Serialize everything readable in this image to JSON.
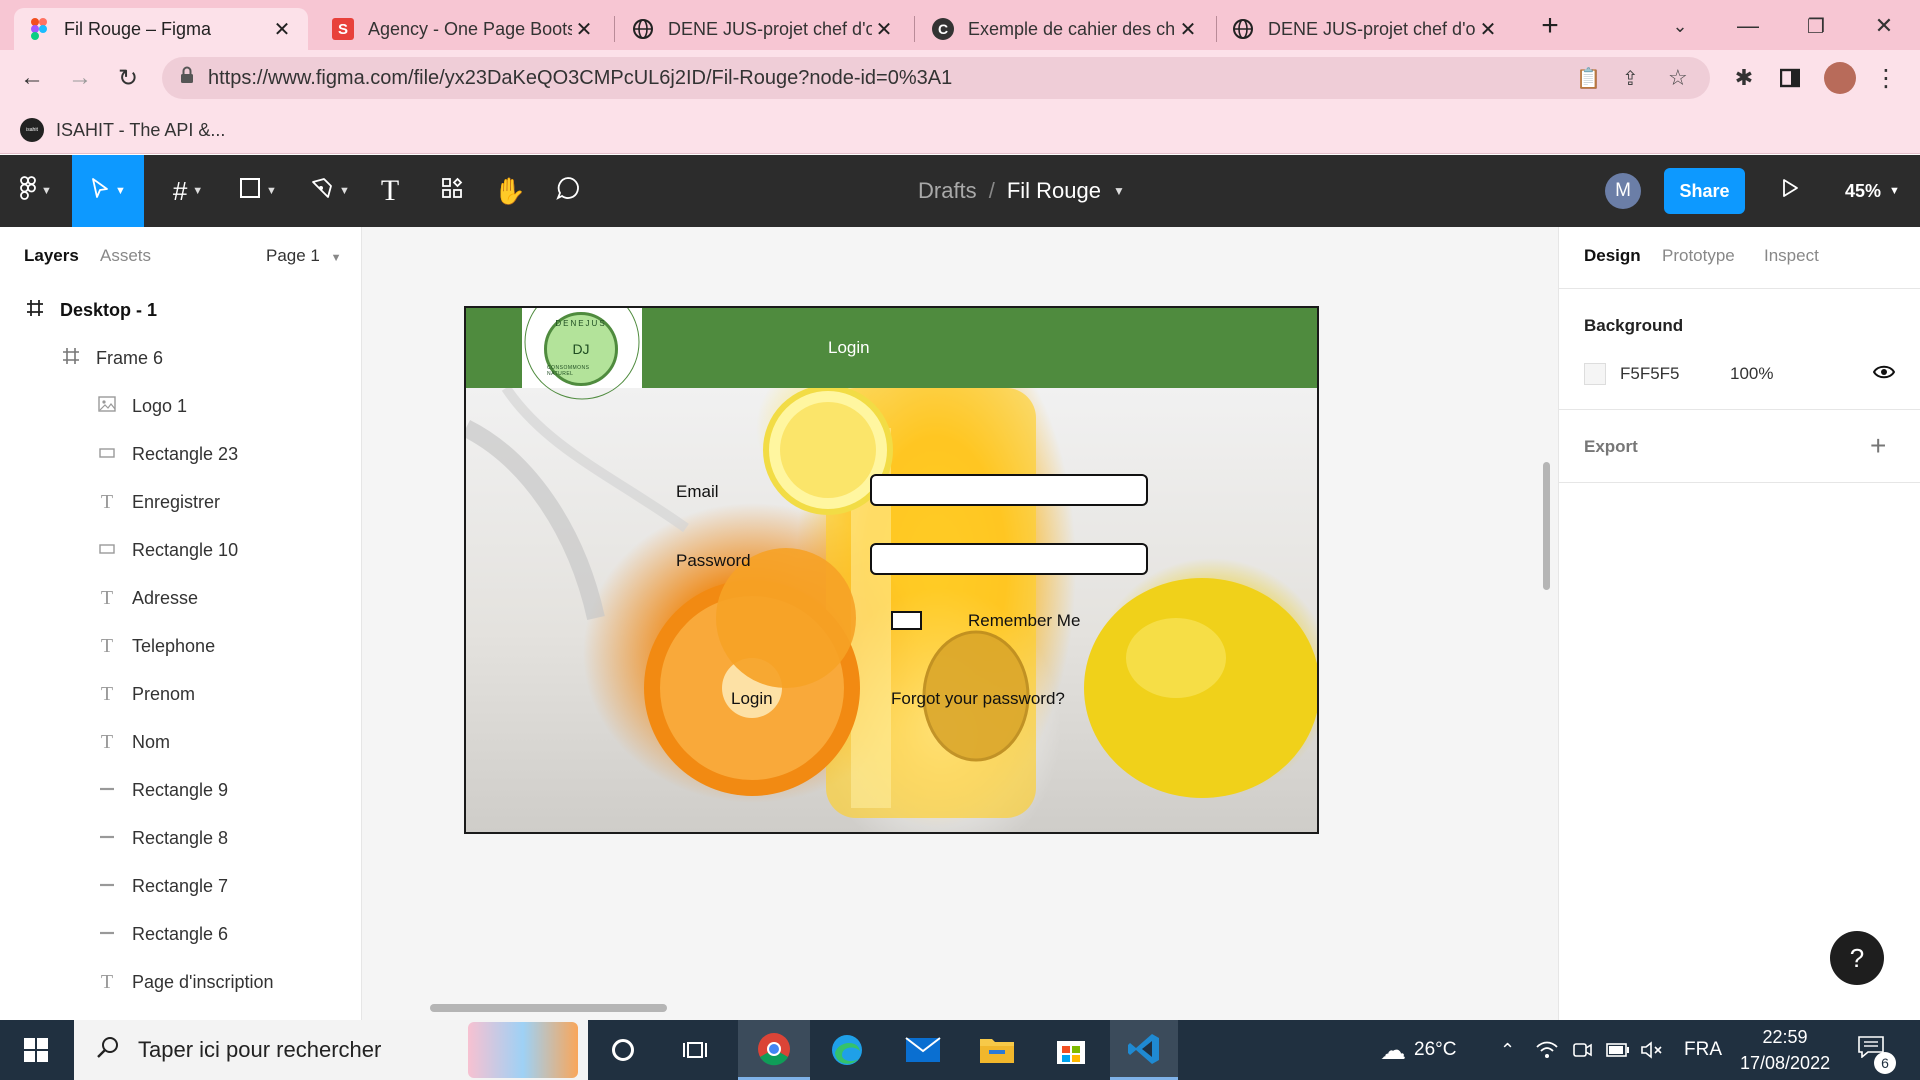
{
  "browser": {
    "tabs": [
      {
        "title": "Fil Rouge – Figma",
        "icon": "figma-icon"
      },
      {
        "title": "Agency - One Page Boots",
        "icon": "s-icon"
      },
      {
        "title": "DENE JUS-projet chef d'o",
        "icon": "globe-icon"
      },
      {
        "title": "Exemple de cahier des ch",
        "icon": "c-icon"
      },
      {
        "title": "DENE JUS-projet chef d'o",
        "icon": "globe-icon"
      }
    ],
    "url": "https://www.figma.com/file/yx23DaKeQO3CMPcUL6j2ID/Fil-Rouge?node-id=0%3A1",
    "bookmark": "ISAHIT - The API &...",
    "bookmark_icon_text": "isahit"
  },
  "figma": {
    "breadcrumb_root": "Drafts",
    "breadcrumb_sep": "/",
    "file_name": "Fil Rouge",
    "avatar_initial": "M",
    "share_label": "Share",
    "zoom": "45%",
    "left_tabs": [
      "Layers",
      "Assets"
    ],
    "page_selector": "Page 1",
    "layers": [
      {
        "name": "Desktop - 1",
        "icon": "frame-icon",
        "level": 0
      },
      {
        "name": "Frame 6",
        "icon": "frame-icon",
        "level": 1
      },
      {
        "name": "Logo 1",
        "icon": "image-icon",
        "level": 2
      },
      {
        "name": "Rectangle 23",
        "icon": "rectangle-icon",
        "level": 2
      },
      {
        "name": "Enregistrer",
        "icon": "text-icon",
        "level": 2
      },
      {
        "name": "Rectangle 10",
        "icon": "rectangle-icon",
        "level": 2
      },
      {
        "name": "Adresse",
        "icon": "text-icon",
        "level": 2
      },
      {
        "name": "Telephone",
        "icon": "text-icon",
        "level": 2
      },
      {
        "name": "Prenom",
        "icon": "text-icon",
        "level": 2
      },
      {
        "name": "Nom",
        "icon": "text-icon",
        "level": 2
      },
      {
        "name": "Rectangle 9",
        "icon": "line-icon",
        "level": 2
      },
      {
        "name": "Rectangle 8",
        "icon": "line-icon",
        "level": 2
      },
      {
        "name": "Rectangle 7",
        "icon": "line-icon",
        "level": 2
      },
      {
        "name": "Rectangle 6",
        "icon": "line-icon",
        "level": 2
      },
      {
        "name": "Page d'inscription",
        "icon": "text-icon",
        "level": 2
      }
    ],
    "right_tabs": [
      "Design",
      "Prototype",
      "Inspect"
    ],
    "background_section": "Background",
    "background_hex": "F5F5F5",
    "background_opacity": "100%",
    "export_section": "Export",
    "help": "?"
  },
  "design": {
    "header_login": "Login",
    "seal_top": "DENEJUS",
    "seal_center": "DJ",
    "seal_bottom": "CONSOMMONS NATUREL",
    "email_label": "Email",
    "password_label": "Password",
    "remember_label": "Remember Me",
    "login_button": "Login",
    "forgot_link": "Forgot your password?",
    "header_color": "#4f8b3e"
  },
  "taskbar": {
    "search_placeholder": "Taper ici pour rechercher",
    "temperature": "26°C",
    "language": "FRA",
    "time": "22:59",
    "date": "17/08/2022",
    "notifications": "6"
  }
}
